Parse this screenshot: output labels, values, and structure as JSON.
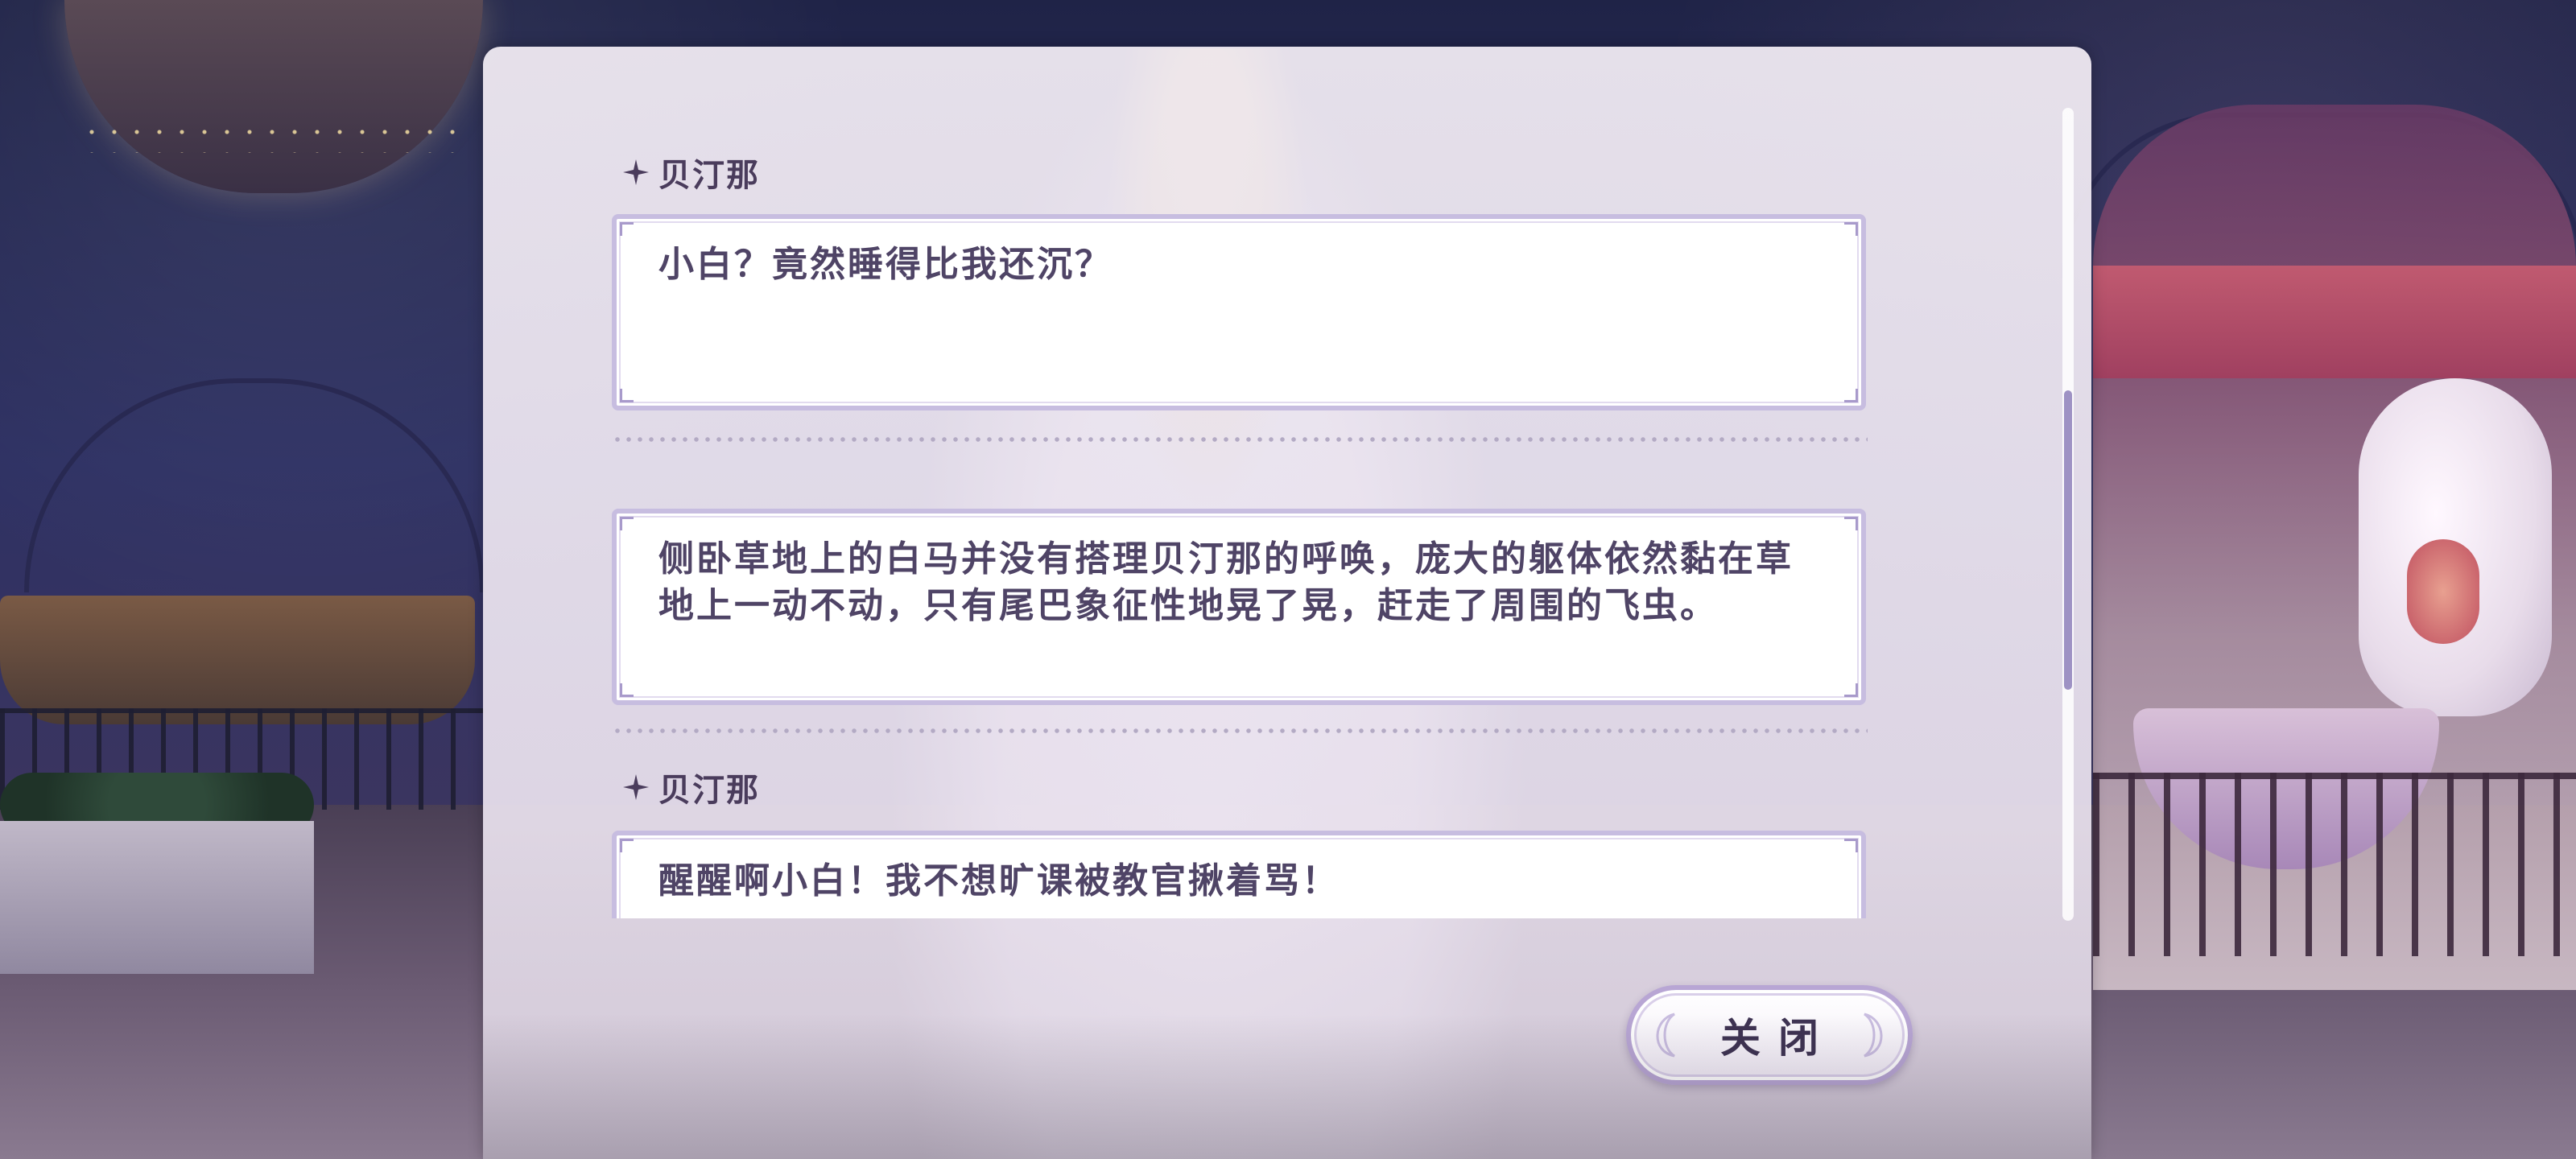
{
  "dialog_log": {
    "entries": [
      {
        "speaker": "贝汀那",
        "text": "小白？竟然睡得比我还沉？"
      },
      {
        "speaker": "",
        "text": "侧卧草地上的白马并没有搭理贝汀那的呼唤，庞大的躯体依然黏在草地上一动不动，只有尾巴象征性地晃了晃，赶走了周围的飞虫。"
      },
      {
        "speaker": "贝汀那",
        "text": "醒醒啊小白！我不想旷课被教官揪着骂！"
      }
    ],
    "scroll_position": 0.55,
    "scroll_visible_fraction": 0.37
  },
  "close_button": {
    "label": "关闭"
  },
  "colors": {
    "panel_bg": "#f2ecf5",
    "bubble_border": "#c7bde0",
    "text": "#4f4466",
    "accent": "#9e92c4"
  },
  "icons": {
    "speaker_marker": "four-point-star-icon"
  }
}
